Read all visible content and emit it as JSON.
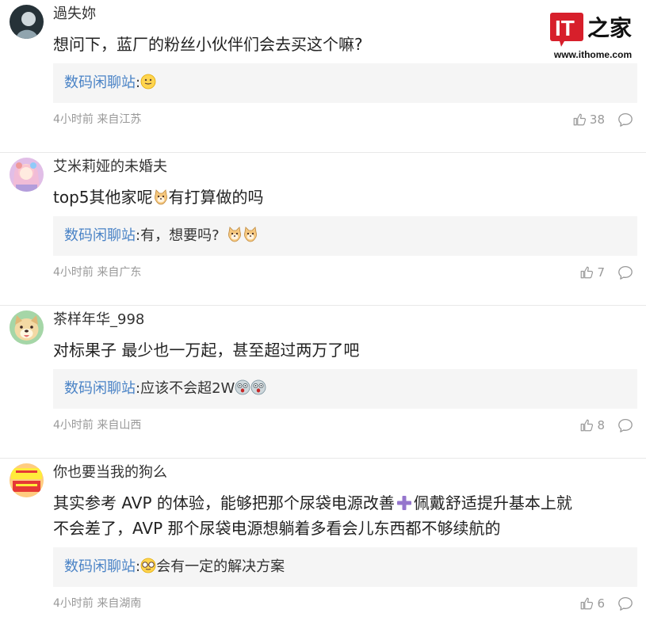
{
  "watermark": {
    "site": "www.ithome.com",
    "brand_mark": "IT之家",
    "brand_color": "#d71f2b"
  },
  "comments": [
    {
      "user": "過失妳",
      "content": "想问下，蓝厂的粉丝小伙伴们会去买这个嘛?",
      "reply_author": "数码闲聊站",
      "reply_text": "",
      "reply_emoji": "smile-emoji",
      "time": "4小时前",
      "location": "来自江苏",
      "likes": "38"
    },
    {
      "user": "艾米莉娅的未婚夫",
      "content_before": "top5其他家呢",
      "content_emoji": "doge-emoji",
      "content_after": "有打算做的吗",
      "reply_author": "数码闲聊站",
      "reply_text": "有，想要吗?",
      "reply_emoji": "doge-emoji",
      "time": "4小时前",
      "location": "来自广东",
      "likes": "7"
    },
    {
      "user": "茶样年华_998",
      "content": "对标果子 最少也一万起，甚至超过两万了吧",
      "reply_author": "数码闲聊站",
      "reply_text": "应该不会超2W",
      "reply_emoji": "shocked-emoji",
      "time": "4小时前",
      "location": "来自山西",
      "likes": "8"
    },
    {
      "user": "你也要当我的狗么",
      "content_line1_before": "其实参考 AVP 的体验，能够把那个尿袋电源改善",
      "content_line1_emoji": "plus-emoji",
      "content_line1_after": "佩戴舒适提升基本上就",
      "content_line2": "不会差了，AVP 那个尿袋电源想躺着多看会儿东西都不够续航的",
      "reply_author": "数码闲聊站",
      "reply_text": "会有一定的解决方案",
      "reply_emoji": "glasses-emoji",
      "time": "4小时前",
      "location": "来自湖南",
      "likes": "6"
    }
  ],
  "colors": {
    "reply_author": "#4a83c6",
    "reply_bg": "#f5f5f5",
    "meta": "#999999",
    "divider": "#e8e8e8"
  },
  "ui": {
    "reply_separator": ":"
  }
}
